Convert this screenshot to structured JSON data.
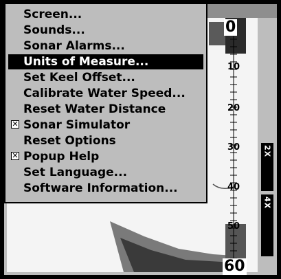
{
  "menu": {
    "items": [
      {
        "label": "Screen...",
        "checked": null,
        "selected": false
      },
      {
        "label": "Sounds...",
        "checked": null,
        "selected": false
      },
      {
        "label": "Sonar Alarms...",
        "checked": null,
        "selected": false
      },
      {
        "label": "Units of Measure...",
        "checked": null,
        "selected": true
      },
      {
        "label": "Set Keel Offset...",
        "checked": null,
        "selected": false
      },
      {
        "label": "Calibrate Water Speed...",
        "checked": null,
        "selected": false
      },
      {
        "label": "Reset Water Distance",
        "checked": null,
        "selected": false
      },
      {
        "label": "Sonar Simulator",
        "checked": true,
        "selected": false
      },
      {
        "label": "Reset Options",
        "checked": null,
        "selected": false
      },
      {
        "label": "Popup Help",
        "checked": true,
        "selected": false
      },
      {
        "label": "Set Language...",
        "checked": null,
        "selected": false
      },
      {
        "label": "Software Information...",
        "checked": null,
        "selected": false
      }
    ],
    "check_glyph": "✕"
  },
  "depth_scale": {
    "top": "0",
    "ticks": [
      "10",
      "20",
      "30",
      "40",
      "50"
    ],
    "bottom": "60"
  },
  "zoom": {
    "box_2x": "2X",
    "box_4x": "4X"
  },
  "colors": {
    "lcd_background": "#bdbdbd",
    "selected_background": "#000000",
    "selected_text": "#ffffff"
  }
}
